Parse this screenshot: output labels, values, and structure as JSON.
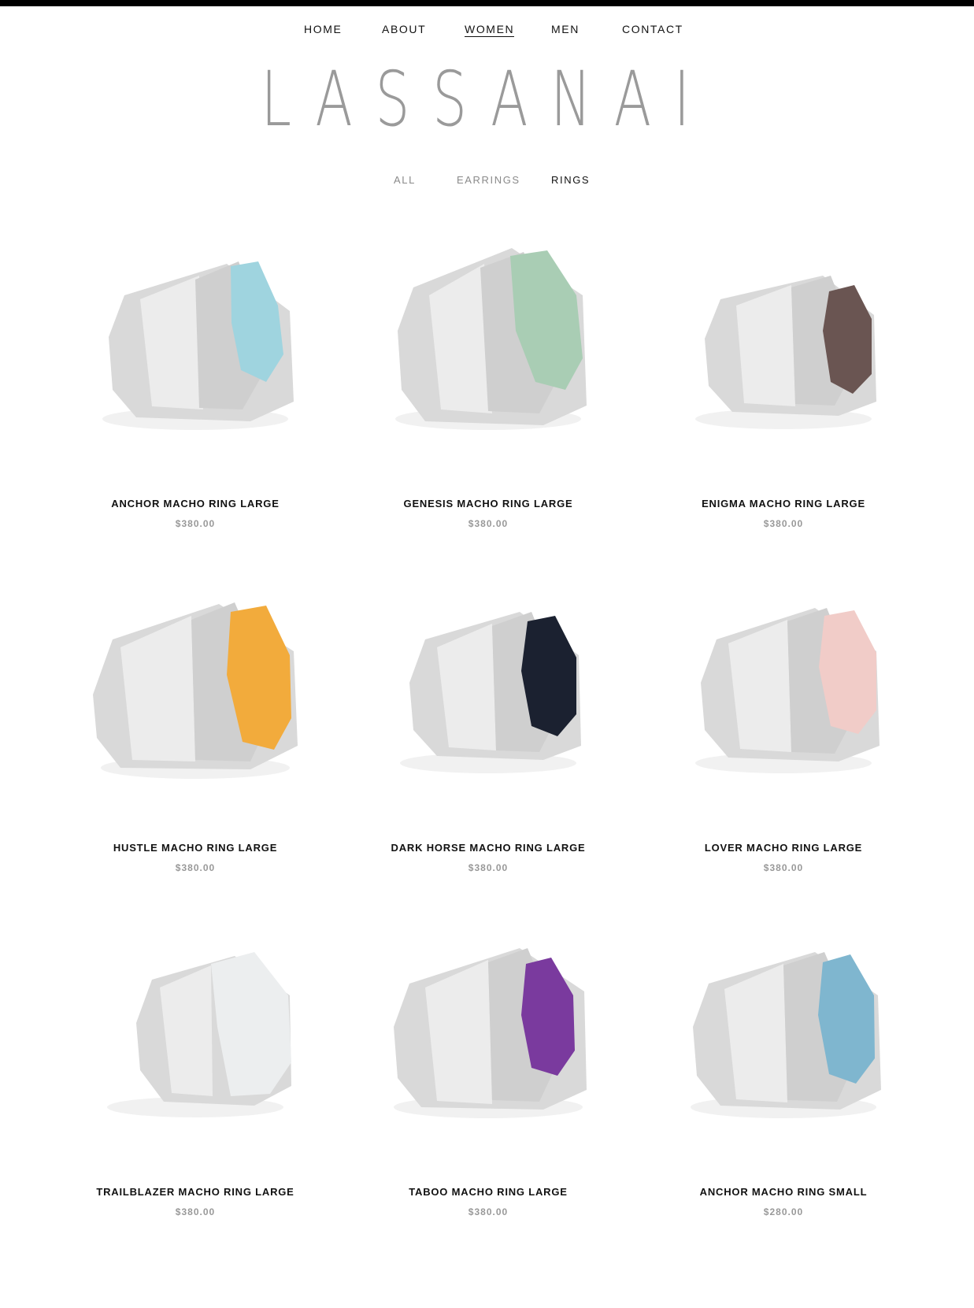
{
  "nav": {
    "items": [
      {
        "label": "HOME",
        "active": false
      },
      {
        "label": "ABOUT",
        "active": false
      },
      {
        "label": "WOMEN",
        "active": true
      },
      {
        "label": "MEN",
        "active": false
      },
      {
        "label": "CONTACT",
        "active": false
      }
    ]
  },
  "brand": {
    "logo_text": "LASSANAI"
  },
  "categories": {
    "items": [
      {
        "label": "ALL",
        "active": false
      },
      {
        "label": "EARRINGS",
        "active": false
      },
      {
        "label": "RINGS",
        "active": true
      }
    ]
  },
  "products": [
    {
      "title": "ANCHOR MACHO RING LARGE",
      "price": "$380.00",
      "stone_color": "#9fd4df"
    },
    {
      "title": "GENESIS MACHO RING LARGE",
      "price": "$380.00",
      "stone_color": "#a9cdb4"
    },
    {
      "title": "ENIGMA MACHO RING LARGE",
      "price": "$380.00",
      "stone_color": "#6a5552"
    },
    {
      "title": "HUSTLE MACHO RING LARGE",
      "price": "$380.00",
      "stone_color": "#f2ab3c"
    },
    {
      "title": "DARK HORSE MACHO RING LARGE",
      "price": "$380.00",
      "stone_color": "#1b2130"
    },
    {
      "title": "LOVER MACHO RING LARGE",
      "price": "$380.00",
      "stone_color": "#f1ccc8"
    },
    {
      "title": "TRAILBLAZER MACHO RING LARGE",
      "price": "$380.00",
      "stone_color": "#eceeef"
    },
    {
      "title": "TABOO MACHO RING LARGE",
      "price": "$380.00",
      "stone_color": "#7a3a9e"
    },
    {
      "title": "ANCHOR MACHO RING SMALL",
      "price": "$280.00",
      "stone_color": "#7fb6cf"
    }
  ]
}
